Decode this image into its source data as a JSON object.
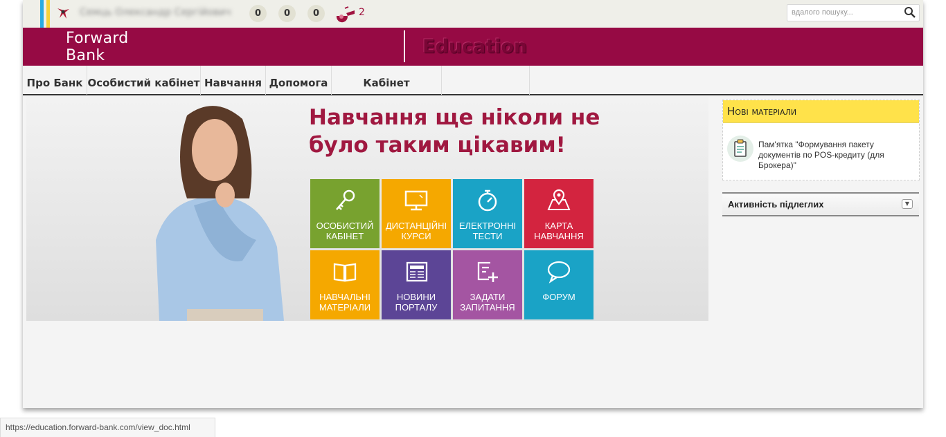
{
  "topbar": {
    "user_name": "Семць Олександр Сергійович",
    "counters": [
      "0",
      "0",
      "0"
    ],
    "whistle_count": "2",
    "search_placeholder": "вдалого пошуку..."
  },
  "header": {
    "logo_line1": "Forward",
    "logo_line2": "Bank",
    "title": "Education",
    "brand_color": "#960a44"
  },
  "nav": {
    "items": [
      {
        "label": "Про Банк"
      },
      {
        "label": "Особистий кабінет"
      },
      {
        "label": "Навчання"
      },
      {
        "label": "Допомога"
      },
      {
        "label": "Кабінет керівника"
      }
    ]
  },
  "banner": {
    "title_line1": "Навчання ще ніколи не",
    "title_line2": "було таким цікавим!",
    "tiles": [
      {
        "line1": "ОСОБИСТИЙ",
        "line2": "КАБІНЕТ",
        "color": "#78a22f",
        "icon": "key-icon"
      },
      {
        "line1": "ДИСТАНЦІЙНІ",
        "line2": "КУРСИ",
        "color": "#f5a800",
        "icon": "monitor-icon"
      },
      {
        "line1": "ЕЛЕКТРОННІ",
        "line2": "ТЕСТИ",
        "color": "#1aa3c6",
        "icon": "stopwatch-icon"
      },
      {
        "line1": "КАРТА",
        "line2": "НАВЧАННЯ",
        "color": "#d3243f",
        "icon": "map-pin-icon"
      },
      {
        "line1": "НАВЧАЛЬНІ",
        "line2": "МАТЕРІАЛИ",
        "color": "#f5a800",
        "icon": "book-icon"
      },
      {
        "line1": "НОВИНИ",
        "line2": "ПОРТАЛУ",
        "color": "#5c4596",
        "icon": "newspaper-icon"
      },
      {
        "line1": "ЗАДАТИ",
        "line2": "ЗАПИТАННЯ",
        "color": "#a455a2",
        "icon": "question-add-icon"
      },
      {
        "line1": "ФОРУМ",
        "line2": "",
        "color": "#1aa3c6",
        "icon": "speech-bubble-icon"
      }
    ]
  },
  "sidebar": {
    "new_materials_title": "Нові матеріали",
    "new_material_item": "Пам'ятка \"Формування пакету документів по POS-кредиту (для Брокера)\"",
    "activity_title": "Активність підлеглих"
  },
  "statusbar": {
    "url": "https://education.forward-bank.com/view_doc.html"
  }
}
